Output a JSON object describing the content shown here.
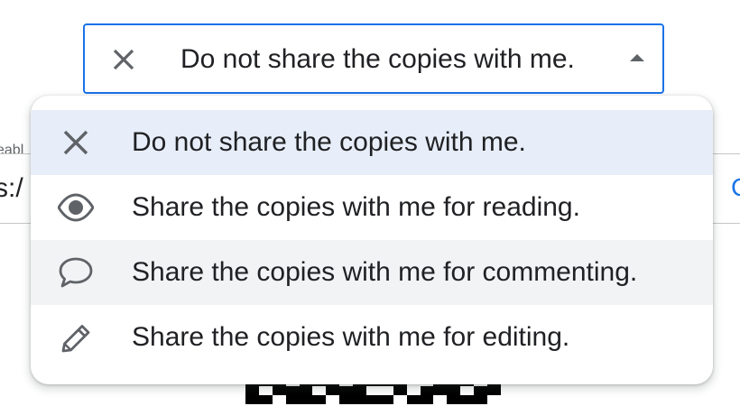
{
  "background": {
    "field_label_fragment": "eabl",
    "url_fragment": "s:/",
    "copy_fragment": "C"
  },
  "select": {
    "value": "Do not share the copies with me.",
    "icon": "close-icon",
    "expanded": true
  },
  "menu": {
    "items": [
      {
        "label": "Do not share the copies with me.",
        "icon": "close-icon",
        "selected": true
      },
      {
        "label": "Share the copies with me for reading.",
        "icon": "eye-icon",
        "selected": false
      },
      {
        "label": "Share the copies with me for commenting.",
        "icon": "comment-icon",
        "selected": false,
        "hovered": true
      },
      {
        "label": "Share the copies with me for editing.",
        "icon": "pencil-icon",
        "selected": false
      }
    ]
  },
  "colors": {
    "accent": "#1a73e8",
    "selected_bg": "#e8eef9",
    "hover_bg": "#f1f3f4",
    "icon": "#5f6368",
    "text": "#202124"
  }
}
